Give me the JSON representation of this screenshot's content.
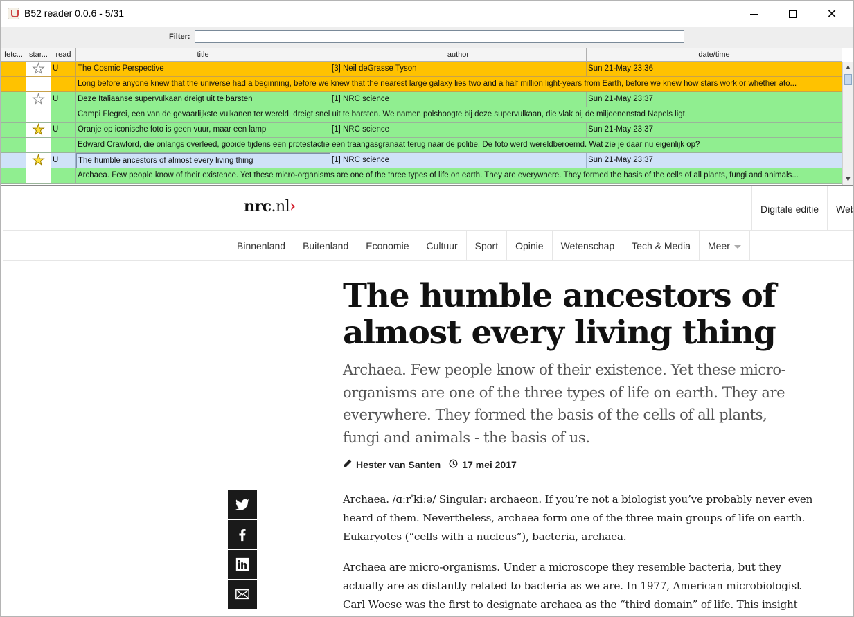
{
  "window": {
    "title": "B52 reader 0.0.6 - 5/31",
    "close_glyph": "✕"
  },
  "filter": {
    "label": "Filter:",
    "value": ""
  },
  "table": {
    "columns": [
      "fetc...",
      "star...",
      "read",
      "title",
      "author",
      "date/time"
    ],
    "rows": [
      {
        "type": "item",
        "color": "orange",
        "star": "empty",
        "read": "U",
        "title": "The Cosmic Perspective",
        "author": "[3] Neil deGrasse Tyson",
        "datetime": "Sun 21-May 23:36"
      },
      {
        "type": "summary",
        "color": "orange",
        "text": "Long before anyone knew that the universe had a beginning, before we knew that the nearest large galaxy lies two and a half million light-years from Earth, before we knew how stars work or whether ato..."
      },
      {
        "type": "item",
        "color": "green",
        "star": "empty",
        "read": "U",
        "title": "Deze Italiaanse supervulkaan dreigt uit te barsten",
        "author": "[1] NRC science",
        "datetime": "Sun 21-May 23:37"
      },
      {
        "type": "summary",
        "color": "green",
        "text": "Campi Flegrei, een van de gevaarlijkste vulkanen ter wereld, dreigt snel uit te barsten. We namen polshoogte bij deze supervulkaan, die vlak bij de miljoenenstad Napels ligt."
      },
      {
        "type": "item",
        "color": "green",
        "star": "full",
        "read": "U",
        "title": "Oranje op iconische foto is geen vuur, maar een lamp",
        "author": "[1] NRC science",
        "datetime": "Sun 21-May 23:37"
      },
      {
        "type": "summary",
        "color": "green",
        "text": "Edward Crawford, die onlangs overleed, gooide tijdens een protestactie een traangasgranaat terug naar de politie. De foto werd wereldberoemd. Wat zíe je daar nu eigenlijk op?"
      },
      {
        "type": "item",
        "color": "blue",
        "star": "full",
        "read": "U",
        "title": "The humble ancestors of almost every living thing",
        "author": "[1] NRC science",
        "datetime": "Sun 21-May 23:37"
      },
      {
        "type": "summary",
        "color": "green",
        "text": "Archaea. Few people know of their existence. Yet these micro-organisms are one of the three types of life on earth. They are everywhere. They formed the basis of the cells of all plants, fungi and animals..."
      }
    ]
  },
  "site": {
    "logo_bold": "nrc",
    "logo_light": ".nl",
    "logo_chevron": "›",
    "top_links": [
      "Digitale editie",
      "Web"
    ],
    "menu": [
      "Binnenland",
      "Buitenland",
      "Economie",
      "Cultuur",
      "Sport",
      "Opinie",
      "Wetenschap",
      "Tech & Media",
      "Meer"
    ]
  },
  "article": {
    "headline": "The humble ancestors of almost every living thing",
    "lead": "Archaea. Few people know of their existence. Yet these micro-organisms are one of the three types of life on earth. They are everywhere. They formed the basis of the cells of all plants, fungi and animals - the basis of us.",
    "author": "Hester van Santen",
    "date": "17 mei 2017",
    "paragraphs": [
      "Archaea. /ɑːrˈkiːə/ Singular: archaeon. If you’re not a biologist you’ve probably never even heard of them. Nevertheless, archaea form one of the three main groups of life on earth. Eukaryotes (“cells with a nucleus”), bacteria, archaea.",
      "Archaea are micro-organisms. Under a microscope they resemble bacteria, but they actually are as distantly related to bacteria as we are. In 1977, American microbiologist Carl Woese was the first to designate archaea as the “third domain” of life. This insight"
    ]
  },
  "share": [
    "twitter-icon",
    "facebook-icon",
    "linkedin-icon",
    "email-icon"
  ]
}
